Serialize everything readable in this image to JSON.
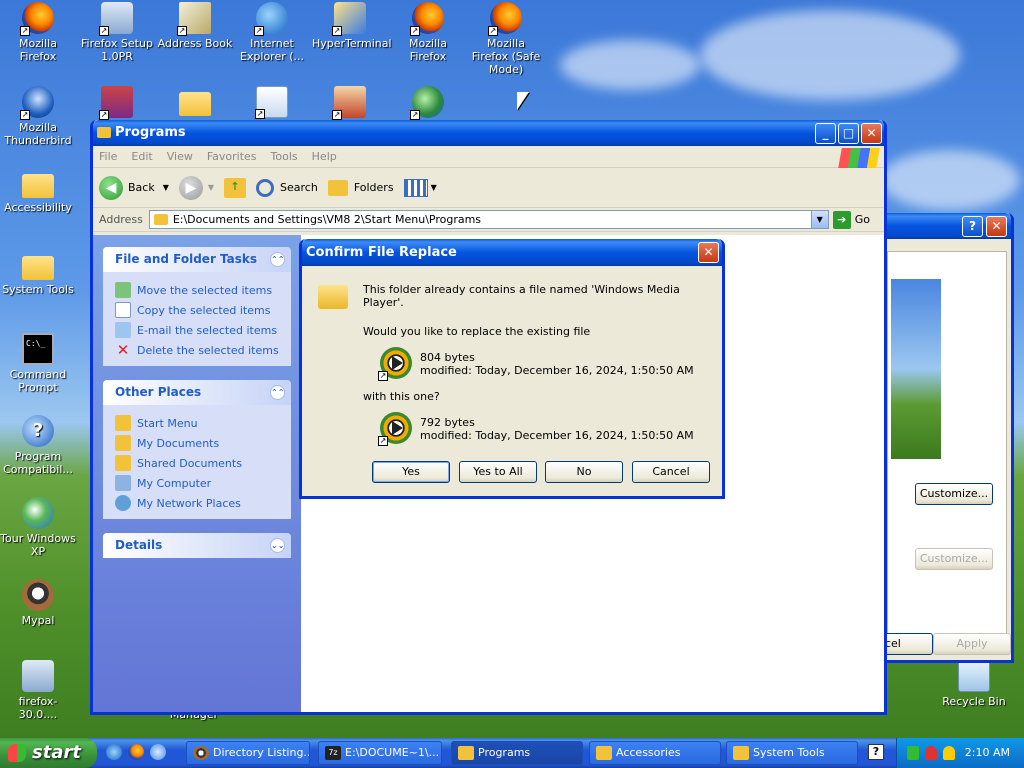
{
  "desktop_icons": [
    {
      "label": "Mozilla Firefox",
      "icon": "firefox-icon"
    },
    {
      "label": "Firefox Setup 1.0PR",
      "icon": "installer-icon"
    },
    {
      "label": "Address Book",
      "icon": "address-book-icon"
    },
    {
      "label": "Internet Explorer (...",
      "icon": "internet-explorer-icon"
    },
    {
      "label": "HyperTerminal",
      "icon": "hyperterminal-icon"
    },
    {
      "label": "Mozilla Firefox",
      "icon": "firefox-icon"
    },
    {
      "label": "Mozilla Firefox (Safe Mode)",
      "icon": "firefox-icon"
    },
    {
      "label": "Mozilla Thunderbird",
      "icon": "thunderbird-icon"
    },
    {
      "label": "Accessibility",
      "icon": "folder-icon"
    },
    {
      "label": "System Tools",
      "icon": "folder-icon"
    },
    {
      "label": "Command Prompt",
      "icon": "command-prompt-icon"
    },
    {
      "label": "Program Compatibil...",
      "icon": "help-icon"
    },
    {
      "label": "Tour Windows XP",
      "icon": "tour-icon"
    },
    {
      "label": "Mypal",
      "icon": "mypal-icon"
    },
    {
      "label": "firefox-30.0....",
      "icon": "installer-icon"
    },
    {
      "label": "Recycle Bin",
      "icon": "recycle-bin-icon"
    },
    {
      "label": "Manager",
      "icon": "manager-icon"
    }
  ],
  "explorer": {
    "title": "Programs",
    "menu": [
      "File",
      "Edit",
      "View",
      "Favorites",
      "Tools",
      "Help"
    ],
    "toolbar": {
      "back": "Back",
      "search": "Search",
      "folders": "Folders"
    },
    "address_label": "Address",
    "address_value": "E:\\Documents and Settings\\VM8 2\\Start Menu\\Programs",
    "go": "Go",
    "panels": {
      "file_tasks": {
        "title": "File and Folder Tasks",
        "items": [
          "Move the selected items",
          "Copy the selected items",
          "E-mail the selected items",
          "Delete the selected items"
        ]
      },
      "other_places": {
        "title": "Other Places",
        "items": [
          "Start Menu",
          "My Documents",
          "Shared Documents",
          "My Computer",
          "My Network Places"
        ]
      },
      "details": {
        "title": "Details"
      }
    }
  },
  "background_dialog": {
    "buttons": {
      "customize": "Customize...",
      "customize_disabled": "Customize...",
      "cancel": "ncel",
      "apply": "Apply"
    }
  },
  "dialog": {
    "title": "Confirm File Replace",
    "message": "This folder already contains a file named 'Windows Media Player'.",
    "question": "Would you like to replace the existing file",
    "existing": {
      "size": "804 bytes",
      "modified": "modified: Today, December 16, 2024, 1:50:50 AM"
    },
    "with_this": "with this one?",
    "new": {
      "size": "792 bytes",
      "modified": "modified: Today, December 16, 2024, 1:50:50 AM"
    },
    "buttons": {
      "yes": "Yes",
      "yes_to_all": "Yes to All",
      "no": "No",
      "cancel": "Cancel"
    }
  },
  "taskbar": {
    "start": "start",
    "tasks": [
      "Directory Listing...",
      "E:\\DOCUME~1\\...",
      "Programs",
      "Accessories",
      "System Tools"
    ],
    "clock": "2:10 AM",
    "colors": {
      "taskbar": "#2157d7",
      "start": "#3a913a",
      "tray": "#0f81d8"
    }
  }
}
